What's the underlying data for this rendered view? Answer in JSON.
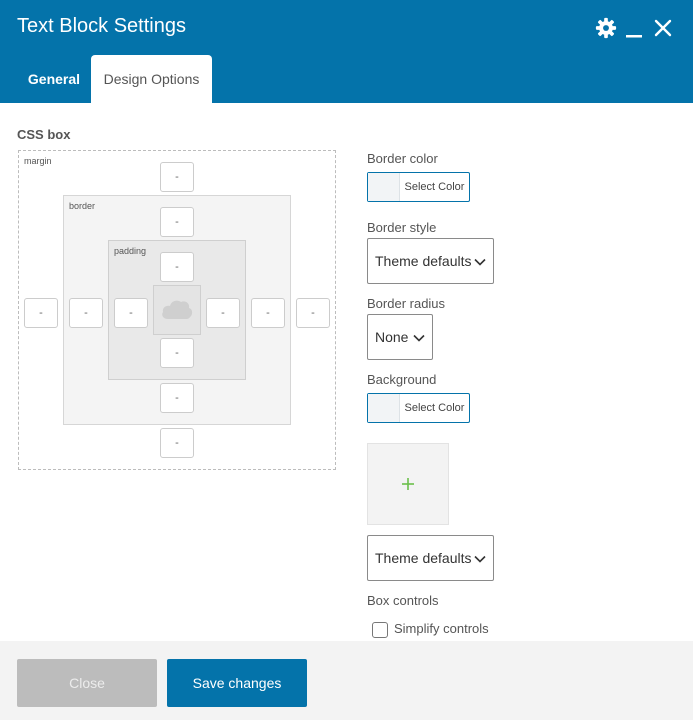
{
  "window": {
    "title": "Text Block Settings",
    "icons": {
      "settings": "gear-icon",
      "minimize": "minimize-icon",
      "close": "close-icon"
    }
  },
  "tabs": [
    {
      "label": "General",
      "active": false
    },
    {
      "label": "Design Options",
      "active": true
    }
  ],
  "css_box": {
    "label": "CSS box",
    "layers": {
      "margin": "margin",
      "border": "border",
      "padding": "padding"
    },
    "placeholder": "-",
    "content_icon": "cloud-icon"
  },
  "border_color": {
    "label": "Border color",
    "button": "Select Color"
  },
  "border_style": {
    "label": "Border style",
    "value": "Theme defaults"
  },
  "border_radius": {
    "label": "Border radius",
    "value": "None"
  },
  "background": {
    "label": "Background",
    "button": "Select Color",
    "image_add_icon": "plus-icon",
    "style_value": "Theme defaults"
  },
  "box_controls": {
    "label": "Box controls",
    "checkbox_label": "Simplify controls",
    "checked": false
  },
  "footer": {
    "close": "Close",
    "save": "Save changes"
  },
  "colors": {
    "header": "#0473aa",
    "accent": "#0473aa",
    "plus": "#6bc04b",
    "close_button": "#bcbcbc",
    "footer_bg": "#f3f3f3"
  }
}
